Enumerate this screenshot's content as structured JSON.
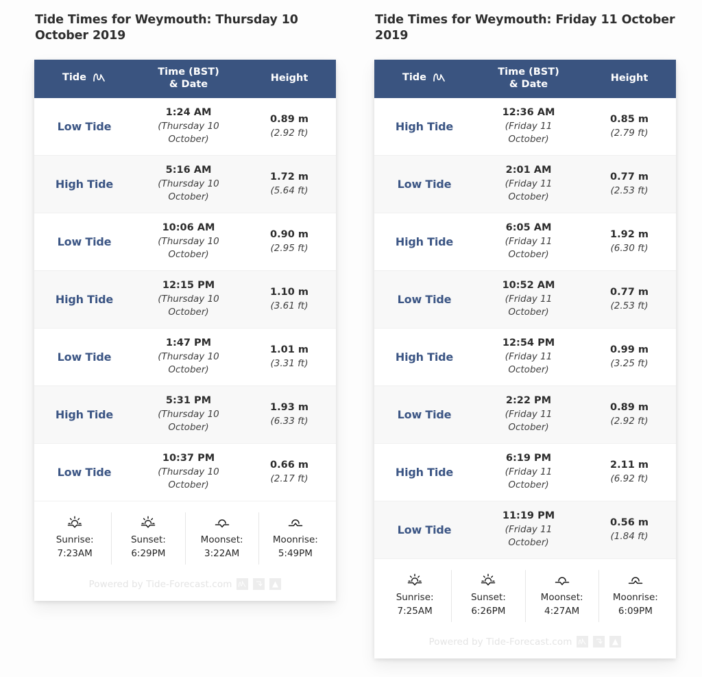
{
  "panels": [
    {
      "title": "Tide Times for Weymouth: Thursday 10 October 2019",
      "columns": {
        "tide": "Tide",
        "time": "Time (BST)",
        "time2": "& Date",
        "height": "Height"
      },
      "rows": [
        {
          "tide": "Low Tide",
          "time": "1:24 AM",
          "date": "(Thursday 10 October)",
          "height_m": "0.89 m",
          "height_ft": "(2.92 ft)"
        },
        {
          "tide": "High Tide",
          "time": "5:16 AM",
          "date": "(Thursday 10 October)",
          "height_m": "1.72 m",
          "height_ft": "(5.64 ft)"
        },
        {
          "tide": "Low Tide",
          "time": "10:06 AM",
          "date": "(Thursday 10 October)",
          "height_m": "0.90 m",
          "height_ft": "(2.95 ft)"
        },
        {
          "tide": "High Tide",
          "time": "12:15 PM",
          "date": "(Thursday 10 October)",
          "height_m": "1.10 m",
          "height_ft": "(3.61 ft)"
        },
        {
          "tide": "Low Tide",
          "time": "1:47 PM",
          "date": "(Thursday 10 October)",
          "height_m": "1.01 m",
          "height_ft": "(3.31 ft)"
        },
        {
          "tide": "High Tide",
          "time": "5:31 PM",
          "date": "(Thursday 10 October)",
          "height_m": "1.93 m",
          "height_ft": "(6.33 ft)"
        },
        {
          "tide": "Low Tide",
          "time": "10:37 PM",
          "date": "(Thursday 10 October)",
          "height_m": "0.66 m",
          "height_ft": "(2.17 ft)"
        }
      ],
      "astro": [
        {
          "icon": "sunrise-icon",
          "label": "Sunrise:",
          "value": "7:23AM"
        },
        {
          "icon": "sunset-icon",
          "label": "Sunset:",
          "value": "6:29PM"
        },
        {
          "icon": "moonset-icon",
          "label": "Moonset:",
          "value": "3:22AM"
        },
        {
          "icon": "moonrise-icon",
          "label": "Moonrise:",
          "value": "5:49PM"
        }
      ],
      "footer": "Powered by Tide-Forecast.com"
    },
    {
      "title": "Tide Times for Weymouth: Friday 11 October 2019",
      "columns": {
        "tide": "Tide",
        "time": "Time (BST)",
        "time2": "& Date",
        "height": "Height"
      },
      "rows": [
        {
          "tide": "High Tide",
          "time": "12:36 AM",
          "date": "(Friday 11 October)",
          "height_m": "0.85 m",
          "height_ft": "(2.79 ft)"
        },
        {
          "tide": "Low Tide",
          "time": "2:01 AM",
          "date": "(Friday 11 October)",
          "height_m": "0.77 m",
          "height_ft": "(2.53 ft)"
        },
        {
          "tide": "High Tide",
          "time": "6:05 AM",
          "date": "(Friday 11 October)",
          "height_m": "1.92 m",
          "height_ft": "(6.30 ft)"
        },
        {
          "tide": "Low Tide",
          "time": "10:52 AM",
          "date": "(Friday 11 October)",
          "height_m": "0.77 m",
          "height_ft": "(2.53 ft)"
        },
        {
          "tide": "High Tide",
          "time": "12:54 PM",
          "date": "(Friday 11 October)",
          "height_m": "0.99 m",
          "height_ft": "(3.25 ft)"
        },
        {
          "tide": "Low Tide",
          "time": "2:22 PM",
          "date": "(Friday 11 October)",
          "height_m": "0.89 m",
          "height_ft": "(2.92 ft)"
        },
        {
          "tide": "High Tide",
          "time": "6:19 PM",
          "date": "(Friday 11 October)",
          "height_m": "2.11 m",
          "height_ft": "(6.92 ft)"
        },
        {
          "tide": "Low Tide",
          "time": "11:19 PM",
          "date": "(Friday 11 October)",
          "height_m": "0.56 m",
          "height_ft": "(1.84 ft)"
        }
      ],
      "astro": [
        {
          "icon": "sunrise-icon",
          "label": "Sunrise:",
          "value": "7:25AM"
        },
        {
          "icon": "sunset-icon",
          "label": "Sunset:",
          "value": "6:26PM"
        },
        {
          "icon": "moonset-icon",
          "label": "Moonset:",
          "value": "4:27AM"
        },
        {
          "icon": "moonrise-icon",
          "label": "Moonrise:",
          "value": "6:09PM"
        }
      ],
      "footer": "Powered by Tide-Forecast.com"
    }
  ],
  "icons": {
    "header_wave": "tide-wave-icon",
    "badges": [
      "wave-chart-badge-icon",
      "download-arrow-badge-icon",
      "mountain-badge-icon"
    ]
  },
  "colors": {
    "header_band": "#3a5480",
    "tide_label": "#3b5584",
    "row_alt": "#f8f8f8",
    "page_bg": "#fdfdfd"
  }
}
